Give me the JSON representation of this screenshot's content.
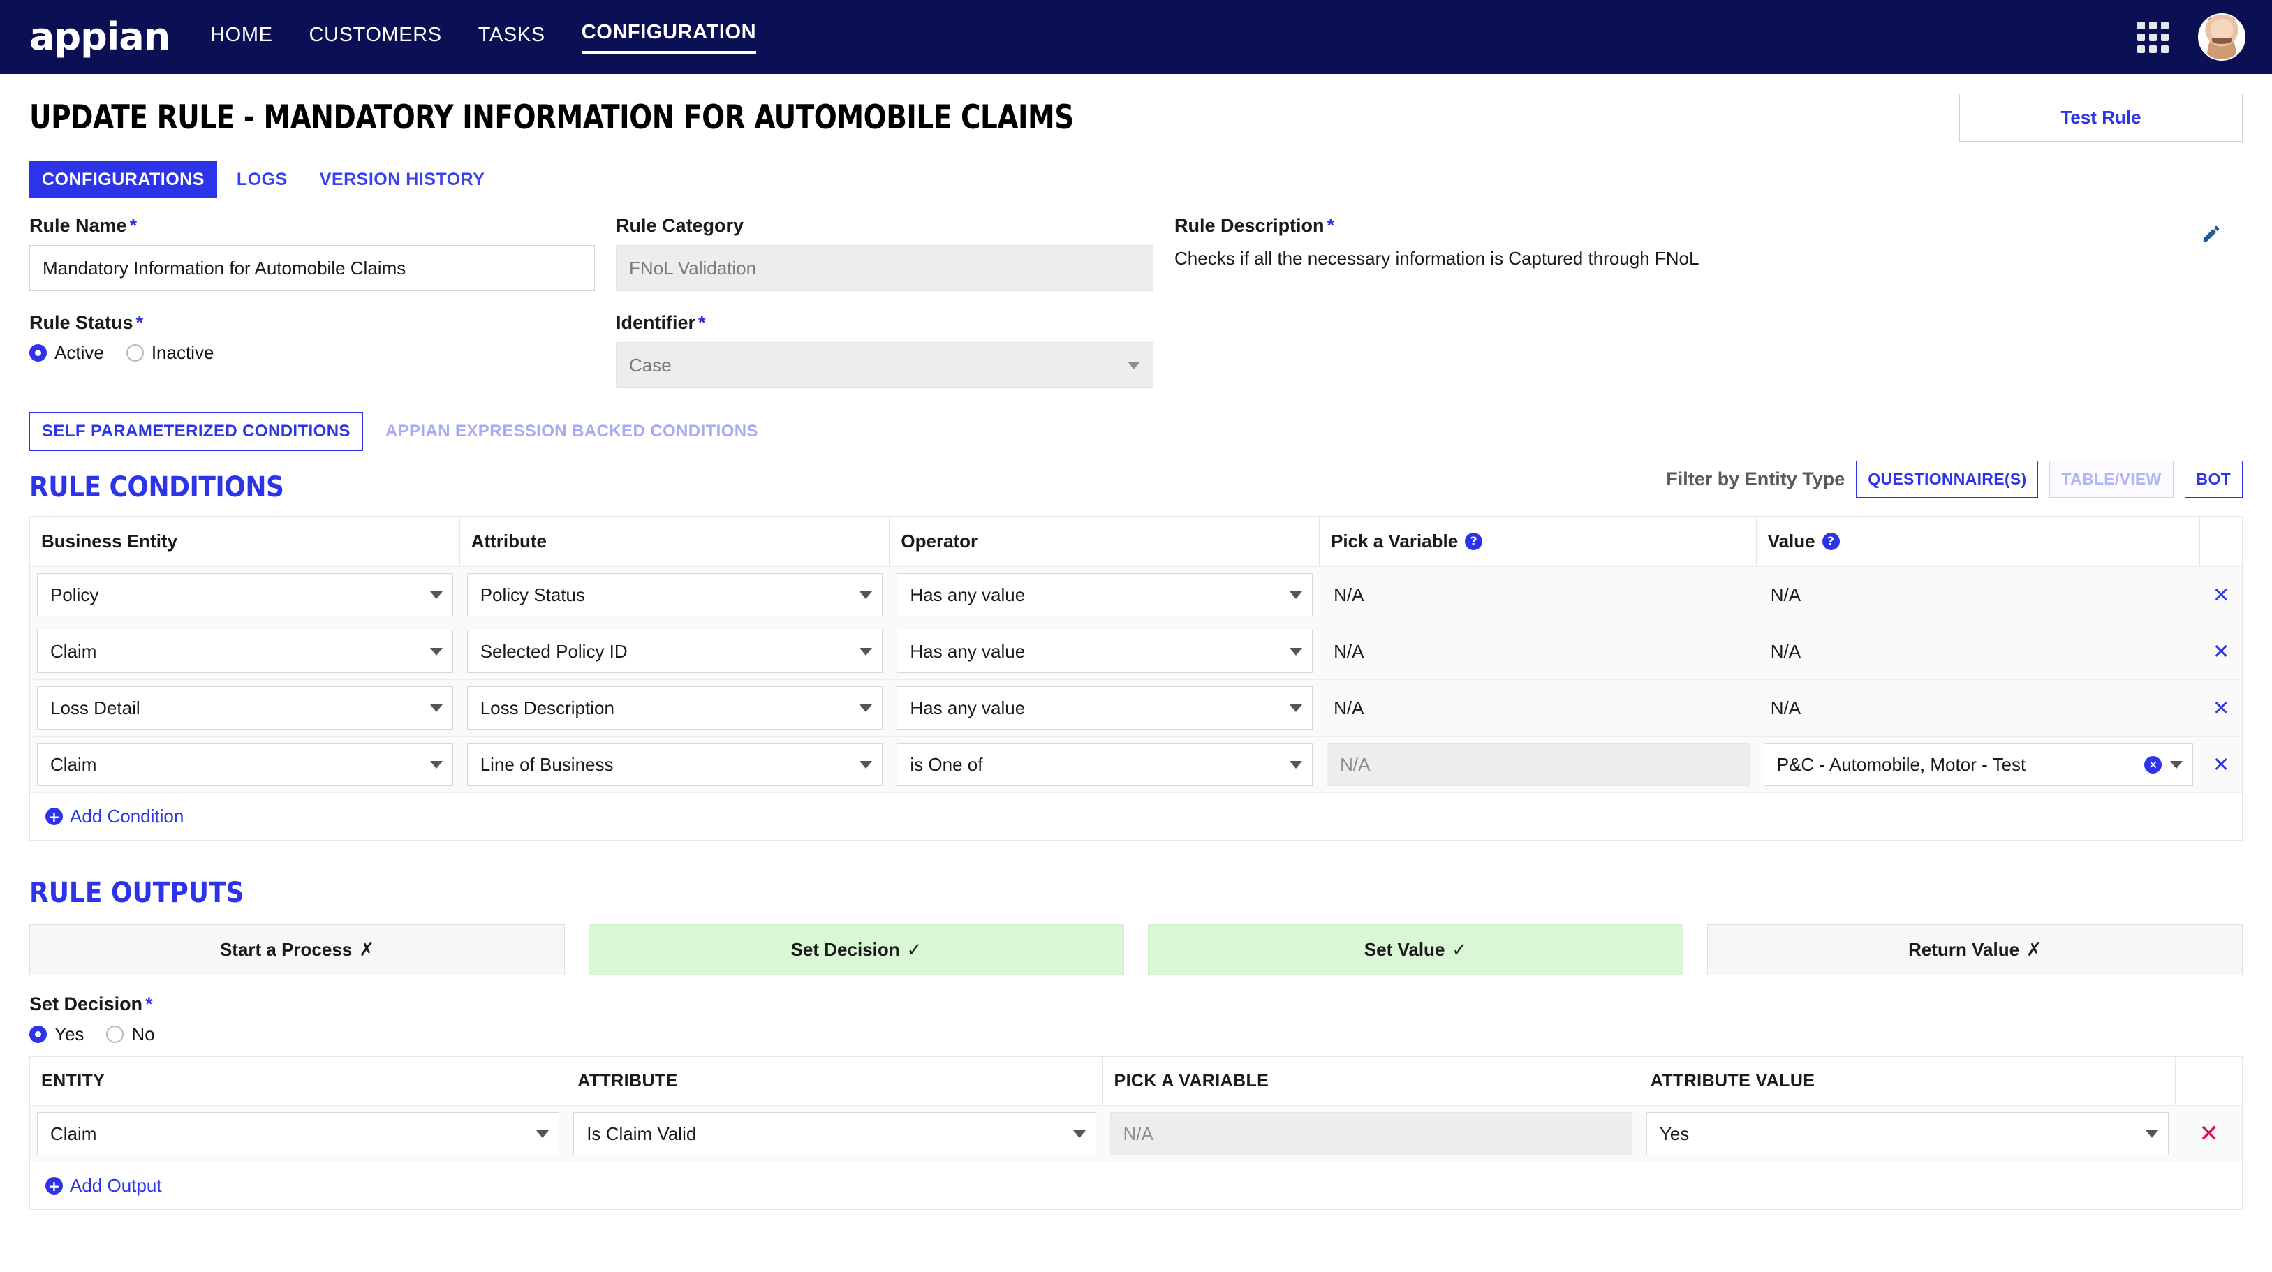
{
  "nav": {
    "logo": "appian",
    "links": [
      {
        "label": "HOME",
        "active": false
      },
      {
        "label": "CUSTOMERS",
        "active": false
      },
      {
        "label": "TASKS",
        "active": false
      },
      {
        "label": "CONFIGURATION",
        "active": true
      }
    ],
    "apps_icon": "grid-icon",
    "avatar_icon": "user-avatar"
  },
  "header": {
    "title": "UPDATE RULE - MANDATORY INFORMATION FOR AUTOMOBILE CLAIMS",
    "test_rule_label": "Test Rule"
  },
  "tabs": [
    {
      "label": "CONFIGURATIONS",
      "active": true
    },
    {
      "label": "LOGS",
      "active": false
    },
    {
      "label": "VERSION HISTORY",
      "active": false
    }
  ],
  "form": {
    "rule_name_label": "Rule Name",
    "rule_name_value": "Mandatory Information for Automobile Claims",
    "rule_category_label": "Rule Category",
    "rule_category_value": "FNoL Validation",
    "rule_description_label": "Rule Description",
    "rule_description_value": "Checks if all the necessary information is Captured through FNoL",
    "rule_status_label": "Rule Status",
    "rule_status_options": [
      {
        "label": "Active",
        "checked": true
      },
      {
        "label": "Inactive",
        "checked": false
      }
    ],
    "identifier_label": "Identifier",
    "identifier_value": "Case",
    "edit_icon": "pencil-icon"
  },
  "condition_tabs": [
    {
      "label": "SELF PARAMETERIZED CONDITIONS",
      "active": true
    },
    {
      "label": "APPIAN EXPRESSION BACKED CONDITIONS",
      "active": false
    }
  ],
  "conditions_section": {
    "title": "RULE CONDITIONS",
    "filter_label": "Filter by Entity Type",
    "filters": [
      {
        "label": "QUESTIONNAIRE(S)",
        "active": true
      },
      {
        "label": "TABLE/VIEW",
        "active": false
      },
      {
        "label": "BOT",
        "active": true
      }
    ],
    "columns": [
      "Business Entity",
      "Attribute",
      "Operator",
      "Pick a Variable",
      "Value"
    ],
    "rows": [
      {
        "entity": "Policy",
        "attribute": "Policy Status",
        "operator": "Has any value",
        "variable": "N/A",
        "variable_disabled": false,
        "value": "N/A",
        "value_is_select": false
      },
      {
        "entity": "Claim",
        "attribute": "Selected Policy ID",
        "operator": "Has any value",
        "variable": "N/A",
        "variable_disabled": false,
        "value": "N/A",
        "value_is_select": false
      },
      {
        "entity": "Loss Detail",
        "attribute": "Loss Description",
        "operator": "Has any value",
        "variable": "N/A",
        "variable_disabled": false,
        "value": "N/A",
        "value_is_select": false
      },
      {
        "entity": "Claim",
        "attribute": "Line of Business",
        "operator": "is One of",
        "variable": "N/A",
        "variable_disabled": true,
        "value": "P&C - Automobile, Motor - Test",
        "value_is_select": true
      }
    ],
    "add_label": "Add Condition"
  },
  "outputs_section": {
    "title": "RULE OUTPUTS",
    "buttons": [
      {
        "label": "Start a Process",
        "mark": "✗",
        "active": false
      },
      {
        "label": "Set Decision",
        "mark": "✓",
        "active": true
      },
      {
        "label": "Set Value",
        "mark": "✓",
        "active": true
      },
      {
        "label": "Return Value",
        "mark": "✗",
        "active": false
      }
    ],
    "set_decision_label": "Set Decision",
    "set_decision_options": [
      {
        "label": "Yes",
        "checked": true
      },
      {
        "label": "No",
        "checked": false
      }
    ],
    "columns": [
      "ENTITY",
      "ATTRIBUTE",
      "PICK A VARIABLE",
      "ATTRIBUTE VALUE"
    ],
    "rows": [
      {
        "entity": "Claim",
        "attribute": "Is Claim Valid",
        "variable": "N/A",
        "value": "Yes"
      }
    ],
    "add_label": "Add Output"
  },
  "colors": {
    "nav_bg": "#0b1054",
    "accent_blue": "#2d34e8",
    "active_green": "#d9f7d4",
    "delete_red": "#e30b4e"
  }
}
